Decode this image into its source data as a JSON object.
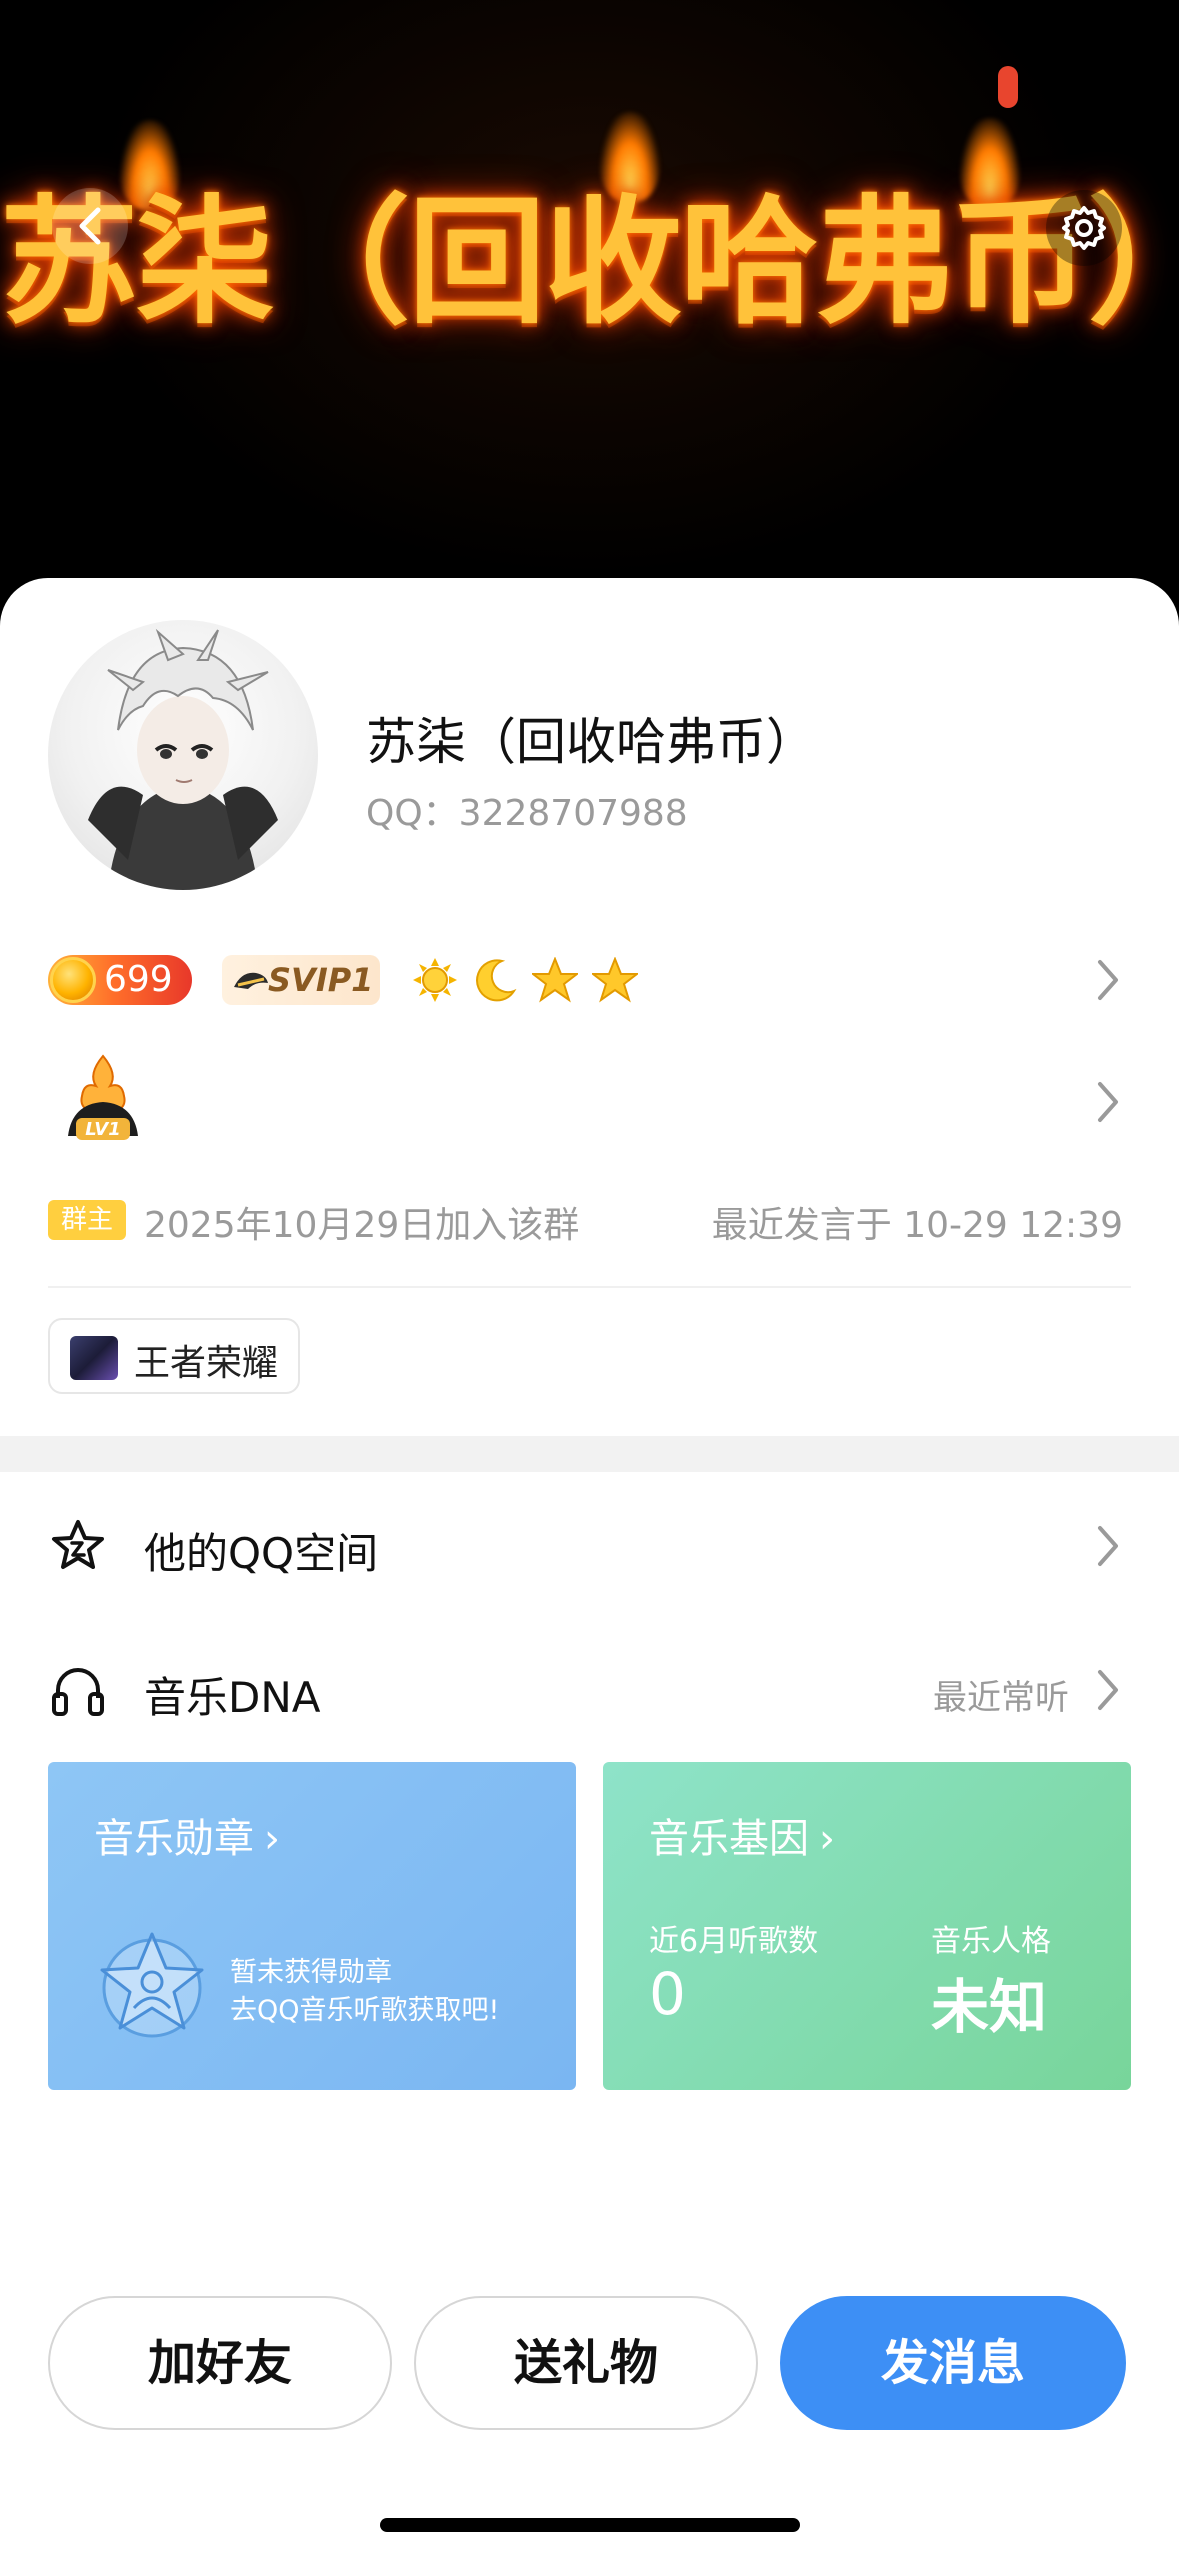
{
  "banner": {
    "title": "苏柒（回收哈弗币）"
  },
  "profile": {
    "name": "苏柒（回收哈弗币）",
    "qq_label": "QQ：3228707988",
    "coin_count": "699",
    "svip_label": "SVIP1",
    "level_badge": "LV1"
  },
  "group_info": {
    "role_tag": "群主",
    "join_text": "2025年10月29日加入该群",
    "last_speak": "最近发言于 10-29 12:39"
  },
  "game": {
    "name": "王者荣耀"
  },
  "list": {
    "qzone_label": "他的QQ空间",
    "music_label": "音乐DNA",
    "music_right": "最近常听"
  },
  "music_medal_card": {
    "title": "音乐勋章",
    "line1": "暂未获得勋章",
    "line2": "去QQ音乐听歌获取吧!"
  },
  "music_gene_card": {
    "title": "音乐基因",
    "listen_label": "近6月听歌数",
    "listen_value": "0",
    "persona_label": "音乐人格",
    "persona_value": "未知"
  },
  "actions": {
    "add_friend": "加好友",
    "send_gift": "送礼物",
    "send_message": "发消息"
  },
  "colors": {
    "primary_button": "#3d8ff5",
    "owner_tag": "#ffcf3f",
    "medal_card": "#8ec6f5",
    "gene_card": "#78d59a"
  }
}
